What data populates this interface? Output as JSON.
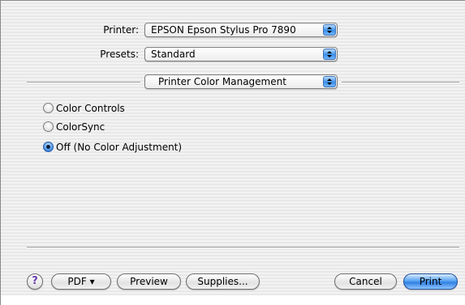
{
  "printer": {
    "label": "Printer:",
    "value": "EPSON Epson Stylus Pro 7890"
  },
  "presets": {
    "label": "Presets:",
    "value": "Standard"
  },
  "panel_menu": {
    "value": "Printer Color Management"
  },
  "color_options": {
    "items": [
      {
        "label": "Color Controls",
        "checked": false
      },
      {
        "label": "ColorSync",
        "checked": false
      },
      {
        "label": "Off (No Color Adjustment)",
        "checked": true
      }
    ]
  },
  "footer": {
    "help_label": "?",
    "pdf_label": "PDF ▾",
    "preview_label": "Preview",
    "supplies_label": "Supplies...",
    "cancel_label": "Cancel",
    "print_label": "Print"
  },
  "colors": {
    "accent_blue": "#3a8fe8",
    "help_purple": "#6a3fb0"
  },
  "icons": {
    "popup_arrows": "up-down-arrows-icon",
    "help": "question-mark-icon"
  }
}
